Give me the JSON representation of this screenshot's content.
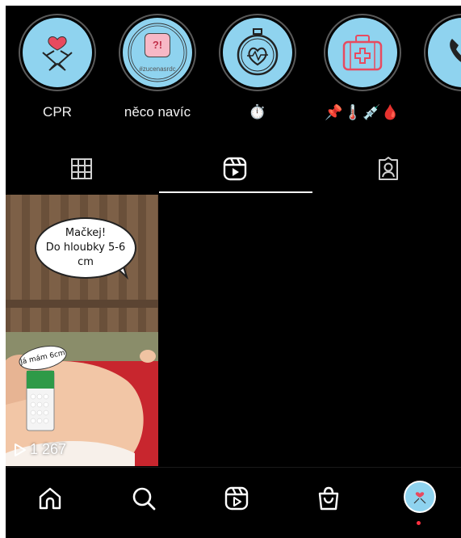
{
  "highlights": [
    {
      "label": "CPR",
      "icon": "hands-heart-icon"
    },
    {
      "label": "něco navíc",
      "icon": "question-heart-icon",
      "inner_text": "?!",
      "watermark": "#zucenasrdc"
    },
    {
      "label": "⏱️",
      "icon": "stopwatch-heart-icon"
    },
    {
      "label": "📌🌡️💉🩸",
      "icon": "first-aid-kit-icon"
    },
    {
      "label": "",
      "icon": "phone-icon"
    }
  ],
  "tabs": [
    {
      "name": "grid",
      "icon": "grid-icon",
      "active": false
    },
    {
      "name": "reels",
      "icon": "reels-icon",
      "active": true
    },
    {
      "name": "tagged",
      "icon": "tagged-person-icon",
      "active": false
    }
  ],
  "reel": {
    "bubble_line1": "Mačkej!",
    "bubble_line2": "Do hloubky 5-6 cm",
    "small_bubble": "Já mám 6cm",
    "views": "1 267"
  },
  "bottom_nav": [
    {
      "name": "home",
      "icon": "home-icon"
    },
    {
      "name": "search",
      "icon": "search-icon"
    },
    {
      "name": "reels",
      "icon": "reels-icon"
    },
    {
      "name": "shop",
      "icon": "shop-bag-icon"
    },
    {
      "name": "profile",
      "icon": "avatar"
    }
  ],
  "colors": {
    "background": "#000000",
    "highlight_fill": "#8fd3ef",
    "accent_red": "#ff3040",
    "text": "#ffffff"
  }
}
